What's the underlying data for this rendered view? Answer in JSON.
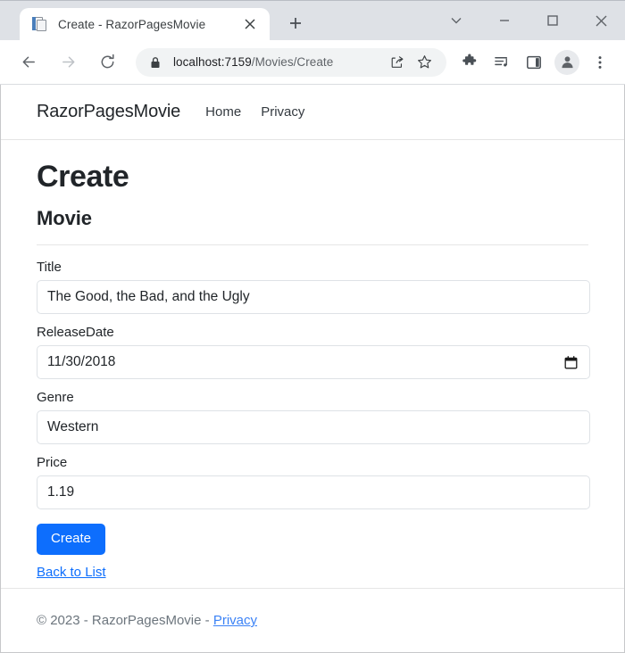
{
  "browser": {
    "tab": {
      "title": "Create - RazorPagesMovie",
      "favicon": "document-page-icon",
      "close_icon": "close-icon"
    },
    "new_tab_icon": "plus-icon",
    "window_controls": [
      {
        "name": "tab-search",
        "icon": "chevron-down-icon"
      },
      {
        "name": "minimize",
        "icon": "minimize-icon"
      },
      {
        "name": "maximize",
        "icon": "maximize-square-icon"
      },
      {
        "name": "close",
        "icon": "close-x-icon"
      }
    ],
    "toolbar": {
      "back_icon": "arrow-left-icon",
      "forward_icon": "arrow-right-icon",
      "reload_icon": "reload-icon",
      "lock_icon": "lock-icon",
      "url_host": "localhost:7159",
      "url_path": "/Movies/Create",
      "url_full": "localhost:7159/Movies/Create",
      "share_icon": "share-icon",
      "bookmark_icon": "star-icon",
      "extensions_icon": "puzzle-piece-icon",
      "media_icon": "media-list-icon",
      "side_panel_icon": "side-panel-icon",
      "profile_icon": "person-avatar-icon",
      "menu_icon": "three-dot-menu-icon"
    }
  },
  "site": {
    "brand": "RazorPagesMovie",
    "nav_links": [
      {
        "label": "Home"
      },
      {
        "label": "Privacy"
      }
    ]
  },
  "page": {
    "title": "Create",
    "subtitle": "Movie",
    "fields": [
      {
        "name": "title",
        "label": "Title",
        "value": "The Good, the Bad, and the Ugly",
        "type": "text"
      },
      {
        "name": "release-date",
        "label": "ReleaseDate",
        "value": "11/30/2018",
        "type": "date"
      },
      {
        "name": "genre",
        "label": "Genre",
        "value": "Western",
        "type": "text"
      },
      {
        "name": "price",
        "label": "Price",
        "value": "1.19",
        "type": "text"
      }
    ],
    "submit_label": "Create",
    "back_link_label": "Back to List"
  },
  "footer": {
    "text": "© 2023 - RazorPagesMovie - ",
    "link_label": "Privacy"
  },
  "colors": {
    "primary": "#0d6efd",
    "tabstrip_bg": "#dee1e6",
    "omnibox_bg": "#f1f3f4",
    "link": "#0d6efd",
    "muted_text": "#6c757d"
  }
}
